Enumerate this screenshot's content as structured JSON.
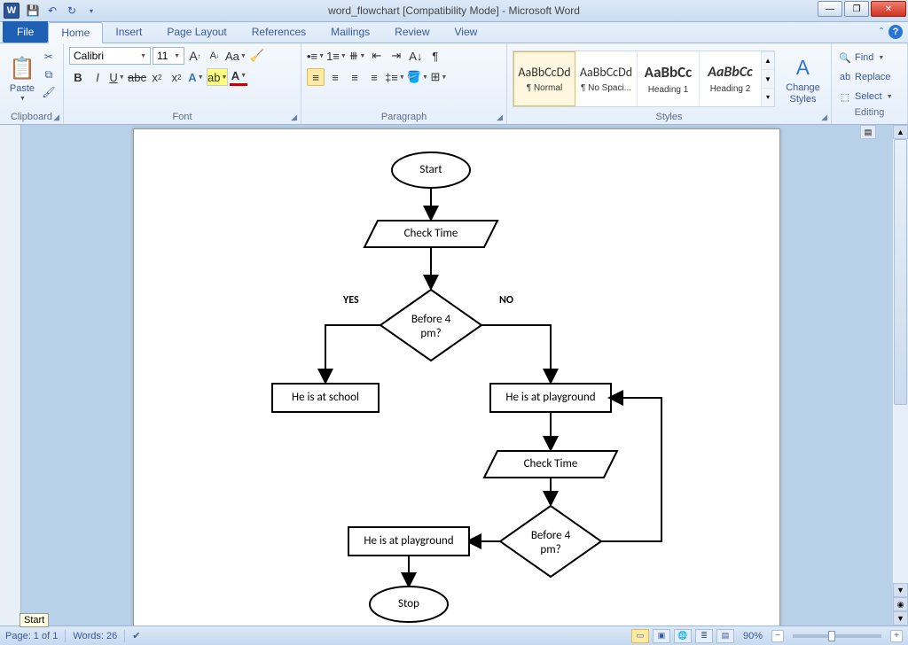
{
  "app": {
    "title": "word_flowchart [Compatibility Mode] - Microsoft Word"
  },
  "tabs": {
    "file": "File",
    "home": "Home",
    "insert": "Insert",
    "pagelayout": "Page Layout",
    "references": "References",
    "mailings": "Mailings",
    "review": "Review",
    "view": "View"
  },
  "ribbon": {
    "clipboard": {
      "label": "Clipboard",
      "paste": "Paste"
    },
    "font": {
      "label": "Font",
      "name": "Calibri",
      "size": "11"
    },
    "paragraph": {
      "label": "Paragraph"
    },
    "styles": {
      "label": "Styles",
      "change": "Change Styles",
      "items": [
        {
          "preview": "AaBbCcDd",
          "name": "¶ Normal"
        },
        {
          "preview": "AaBbCcDd",
          "name": "¶ No Spaci..."
        },
        {
          "preview": "AaBbCc",
          "name": "Heading 1"
        },
        {
          "preview": "AaBbCc",
          "name": "Heading 2"
        }
      ]
    },
    "editing": {
      "label": "Editing",
      "find": "Find",
      "replace": "Replace",
      "select": "Select"
    }
  },
  "flowchart": {
    "start": "Start",
    "check1": "Check Time",
    "dec1a": "Before 4",
    "dec1b": "pm?",
    "yes": "YES",
    "no": "NO",
    "school": "He is at school",
    "play1": "He is at playground",
    "check2": "Check Time",
    "dec2a": "Before 4",
    "dec2b": "pm?",
    "play2": "He is at playground",
    "stop": "Stop"
  },
  "status": {
    "page": "Page: 1 of 1",
    "words": "Words: 26",
    "zoom": "90%",
    "tooltip": "Start"
  }
}
